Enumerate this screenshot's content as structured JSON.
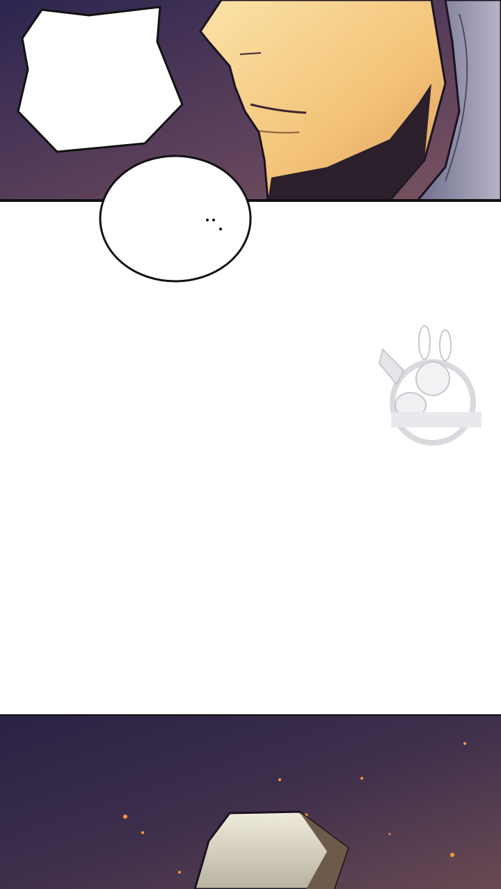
{
  "page": {
    "background": "#ffffff"
  },
  "panels": {
    "top": {
      "description_colors": {
        "bg_dark": "#2e2648",
        "bg_mid": "#6b4a5c",
        "skin_light": "#f6cf86",
        "skin_shadow": "#c98a52",
        "hood": "#8f8ea6"
      }
    },
    "bottom": {
      "description_colors": {
        "bg_dark": "#2a2240",
        "bg_mid": "#5a3d52",
        "spark": "#ff9b3a",
        "object": "#d9d4c4"
      }
    }
  },
  "speech_bubbles": [
    {
      "kind": "shout",
      "text": ""
    },
    {
      "kind": "round",
      "text": "··"
    }
  ],
  "watermark": {
    "icon": "bunny-girl-mascot-icon"
  }
}
